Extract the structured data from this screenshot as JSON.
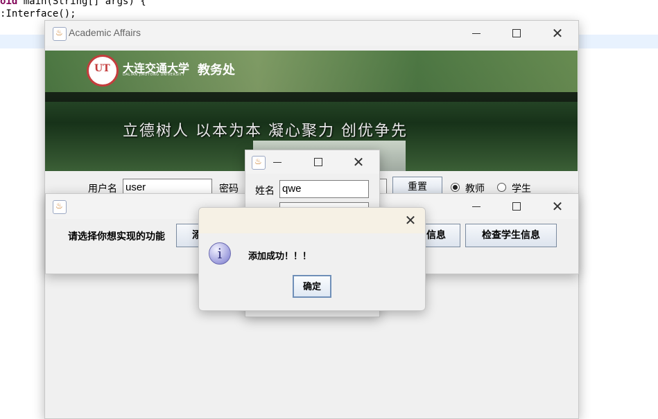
{
  "editor": {
    "line1_kw": "oid",
    "line1_rest": " main(String[] args) {",
    "line2": ":Interface();"
  },
  "main_window": {
    "title": "Academic Affairs",
    "banner": {
      "logo_text": "UT",
      "school_name": "大连交通大学",
      "school_name_en": "DALIAN JIAOTONG UNIVERSITY",
      "office": "教务处",
      "slogan": "立德树人 以本为本 凝心聚力 创优争先"
    },
    "login": {
      "username_label": "用户名",
      "username_value": "user",
      "password_label": "密码",
      "reset_label": "重置",
      "role_teacher": "教师",
      "role_student": "学生",
      "selected_role": "教师"
    }
  },
  "function_window": {
    "prompt": "请选择你想实现的功能",
    "add_button_label": "添",
    "info_button_label": "信息",
    "check_student_label": "检查学生信息"
  },
  "add_window": {
    "name_label": "姓名",
    "name_value": "qwe"
  },
  "dialog": {
    "message": "添加成功！！！",
    "ok_label": "确定",
    "icon_glyph": "i"
  }
}
